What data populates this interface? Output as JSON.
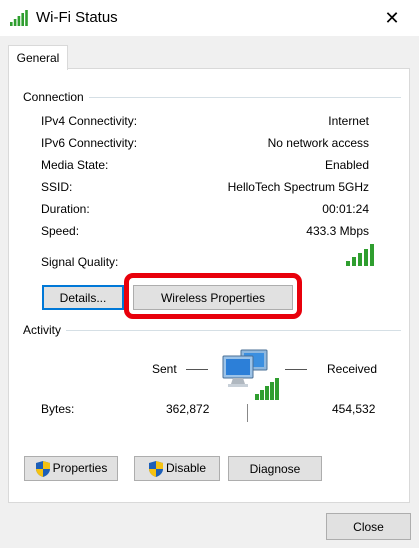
{
  "window": {
    "title": "Wi-Fi Status",
    "close_glyph": "✕"
  },
  "tabs": [
    {
      "label": "General",
      "selected": true
    }
  ],
  "connection": {
    "group_label": "Connection",
    "rows": [
      {
        "label": "IPv4 Connectivity:",
        "value": "Internet"
      },
      {
        "label": "IPv6 Connectivity:",
        "value": "No network access"
      },
      {
        "label": "Media State:",
        "value": "Enabled"
      },
      {
        "label": "SSID:",
        "value": "HelloTech Spectrum 5GHz"
      },
      {
        "label": "Duration:",
        "value": "00:01:24"
      },
      {
        "label": "Speed:",
        "value": "433.3 Mbps"
      }
    ],
    "signal_label": "Signal Quality:",
    "signal_bars_filled": 5,
    "signal_bars_total": 5,
    "details_button": "Details...",
    "wireless_properties_button": "Wireless Properties"
  },
  "activity": {
    "group_label": "Activity",
    "sent_label": "Sent",
    "received_label": "Received",
    "bytes_label": "Bytes:",
    "bytes_sent": "362,872",
    "bytes_received": "454,532"
  },
  "buttons": {
    "properties": "Properties",
    "disable": "Disable",
    "diagnose": "Diagnose",
    "close": "Close"
  },
  "colors": {
    "signal_green": "#2f9e2f",
    "highlight_red": "#e8000b",
    "focus_blue": "#0078d7"
  },
  "icons": {
    "title": "wifi-signal-icon",
    "network": "network-computers-icon",
    "shield": "uac-shield-icon"
  }
}
